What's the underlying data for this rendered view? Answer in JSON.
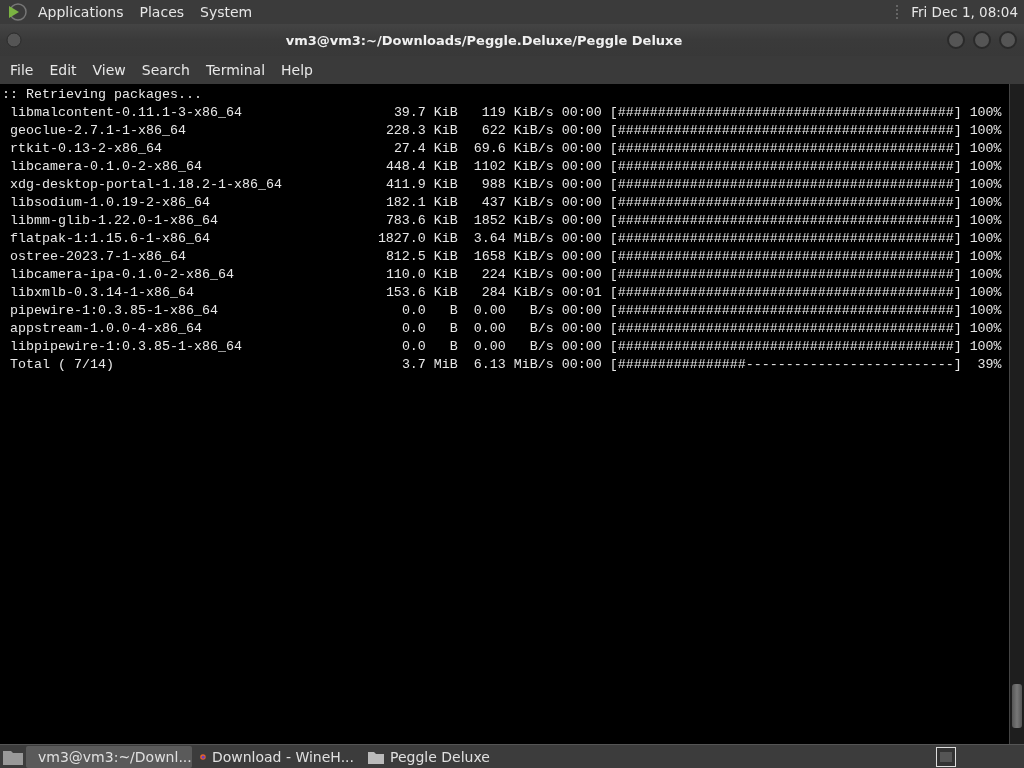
{
  "top_panel": {
    "menus": [
      "Applications",
      "Places",
      "System"
    ],
    "clock": "Fri Dec 1, 08:04"
  },
  "window": {
    "title": "vm3@vm3:~/Downloads/Peggle.Deluxe/Peggle Deluxe"
  },
  "menu_bar": [
    "File",
    "Edit",
    "View",
    "Search",
    "Terminal",
    "Help"
  ],
  "terminal": {
    "header": ":: Retrieving packages...",
    "rows": [
      {
        "name": "libmalcontent-0.11.1-3-x86_64",
        "size": "39.7",
        "unit": "KiB",
        "speed": "119",
        "rate_unit": "KiB/s",
        "time": "00:00",
        "bar": "[##########################################]",
        "percent": "100%"
      },
      {
        "name": "geoclue-2.7.1-1-x86_64",
        "size": "228.3",
        "unit": "KiB",
        "speed": "622",
        "rate_unit": "KiB/s",
        "time": "00:00",
        "bar": "[##########################################]",
        "percent": "100%"
      },
      {
        "name": "rtkit-0.13-2-x86_64",
        "size": "27.4",
        "unit": "KiB",
        "speed": "69.6",
        "rate_unit": "KiB/s",
        "time": "00:00",
        "bar": "[##########################################]",
        "percent": "100%"
      },
      {
        "name": "libcamera-0.1.0-2-x86_64",
        "size": "448.4",
        "unit": "KiB",
        "speed": "1102",
        "rate_unit": "KiB/s",
        "time": "00:00",
        "bar": "[##########################################]",
        "percent": "100%"
      },
      {
        "name": "xdg-desktop-portal-1.18.2-1-x86_64",
        "size": "411.9",
        "unit": "KiB",
        "speed": "988",
        "rate_unit": "KiB/s",
        "time": "00:00",
        "bar": "[##########################################]",
        "percent": "100%"
      },
      {
        "name": "libsodium-1.0.19-2-x86_64",
        "size": "182.1",
        "unit": "KiB",
        "speed": "437",
        "rate_unit": "KiB/s",
        "time": "00:00",
        "bar": "[##########################################]",
        "percent": "100%"
      },
      {
        "name": "libmm-glib-1.22.0-1-x86_64",
        "size": "783.6",
        "unit": "KiB",
        "speed": "1852",
        "rate_unit": "KiB/s",
        "time": "00:00",
        "bar": "[##########################################]",
        "percent": "100%"
      },
      {
        "name": "flatpak-1:1.15.6-1-x86_64",
        "size": "1827.0",
        "unit": "KiB",
        "speed": "3.64",
        "rate_unit": "MiB/s",
        "time": "00:00",
        "bar": "[##########################################]",
        "percent": "100%"
      },
      {
        "name": "ostree-2023.7-1-x86_64",
        "size": "812.5",
        "unit": "KiB",
        "speed": "1658",
        "rate_unit": "KiB/s",
        "time": "00:00",
        "bar": "[##########################################]",
        "percent": "100%"
      },
      {
        "name": "libcamera-ipa-0.1.0-2-x86_64",
        "size": "110.0",
        "unit": "KiB",
        "speed": "224",
        "rate_unit": "KiB/s",
        "time": "00:00",
        "bar": "[##########################################]",
        "percent": "100%"
      },
      {
        "name": "libxmlb-0.3.14-1-x86_64",
        "size": "153.6",
        "unit": "KiB",
        "speed": "284",
        "rate_unit": "KiB/s",
        "time": "00:01",
        "bar": "[##########################################]",
        "percent": "100%"
      },
      {
        "name": "pipewire-1:0.3.85-1-x86_64",
        "size": "0.0",
        "unit": "B",
        "speed": "0.00",
        "rate_unit": "B/s",
        "time": "00:00",
        "bar": "[##########################################]",
        "percent": "100%"
      },
      {
        "name": "appstream-1.0.0-4-x86_64",
        "size": "0.0",
        "unit": "B",
        "speed": "0.00",
        "rate_unit": "B/s",
        "time": "00:00",
        "bar": "[##########################################]",
        "percent": "100%"
      },
      {
        "name": "libpipewire-1:0.3.85-1-x86_64",
        "size": "0.0",
        "unit": "B",
        "speed": "0.00",
        "rate_unit": "B/s",
        "time": "00:00",
        "bar": "[##########################################]",
        "percent": "100%"
      },
      {
        "name": "Total ( 7/14)",
        "size": "3.7",
        "unit": "MiB",
        "speed": "6.13",
        "rate_unit": "MiB/s",
        "time": "00:00",
        "bar": "[################--------------------------]",
        "percent": "39%"
      }
    ]
  },
  "taskbar": {
    "tasks": [
      {
        "kind": "terminal",
        "label": "vm3@vm3:~/Downl...",
        "selected": true
      },
      {
        "kind": "browser",
        "label": "Download - WineH...",
        "selected": false
      },
      {
        "kind": "folder",
        "label": "Peggle Deluxe",
        "selected": false
      }
    ]
  }
}
